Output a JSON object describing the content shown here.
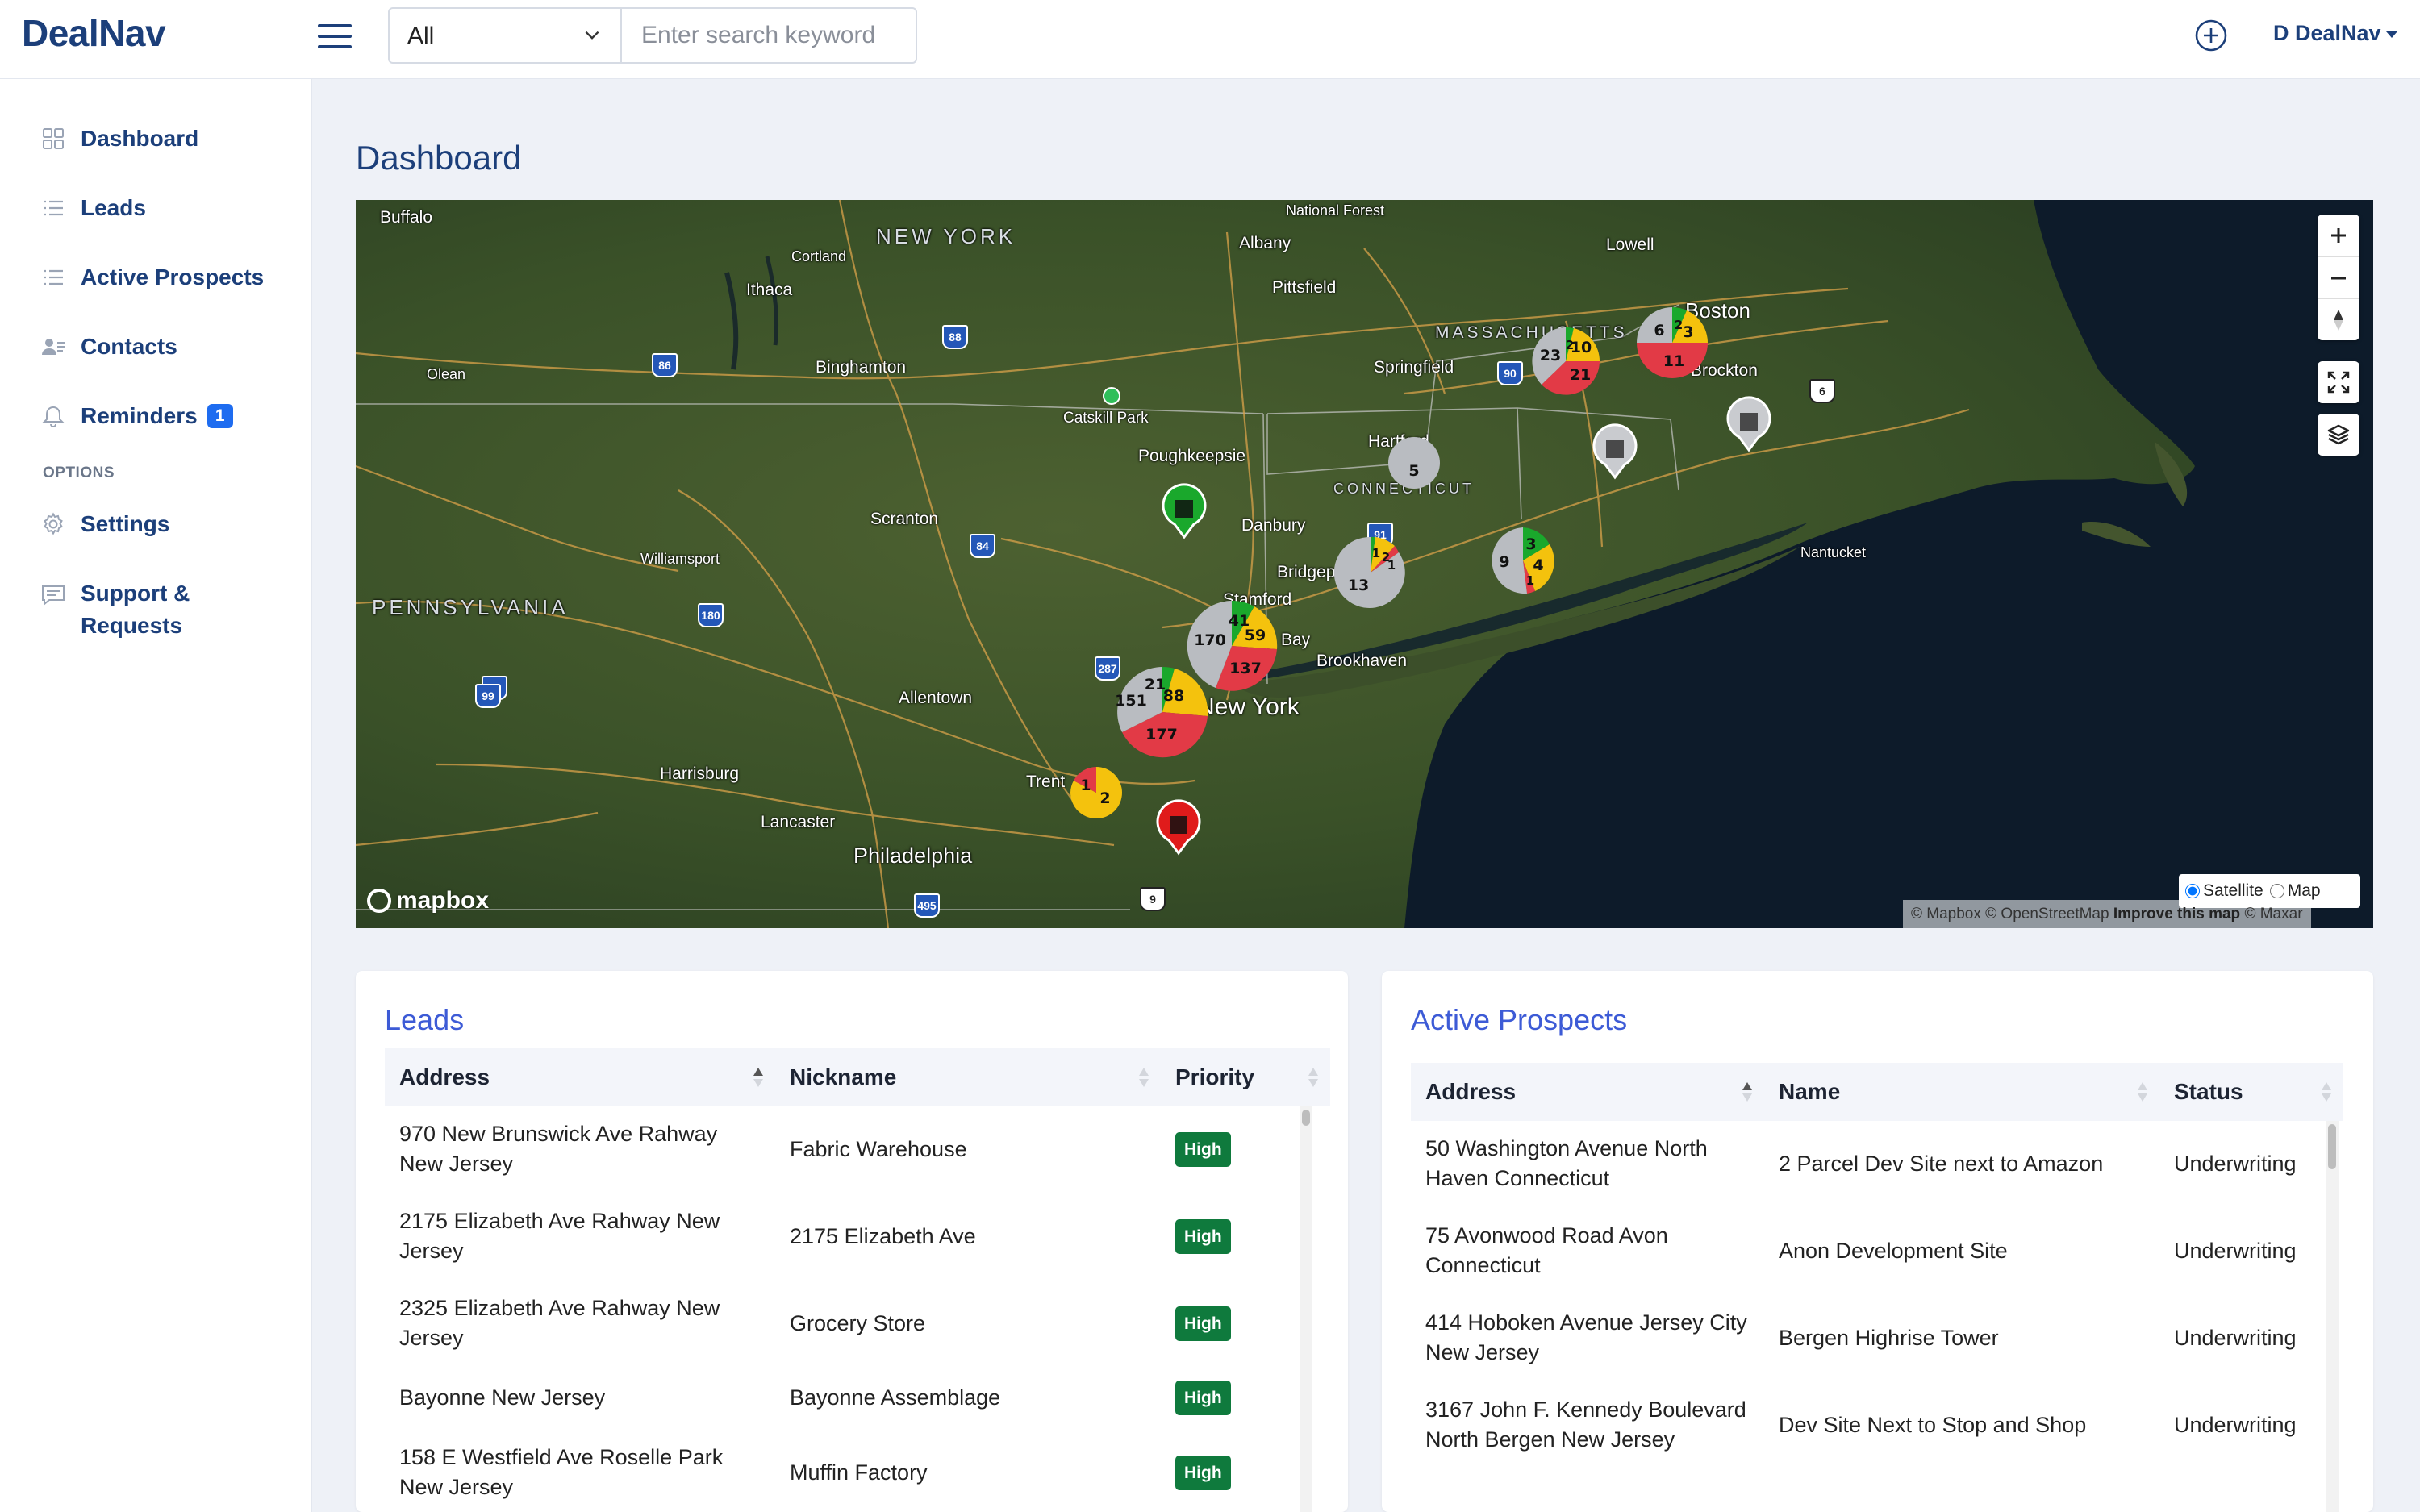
{
  "app": {
    "logo": "DealNav"
  },
  "topbar": {
    "search_filter": "All",
    "search_placeholder": "Enter search keyword",
    "user_label": "D DealNav"
  },
  "sidebar": {
    "items": [
      {
        "label": "Dashboard",
        "icon": "grid-icon"
      },
      {
        "label": "Leads",
        "icon": "list-icon"
      },
      {
        "label": "Active Prospects",
        "icon": "list-icon"
      },
      {
        "label": "Contacts",
        "icon": "contacts-icon"
      },
      {
        "label": "Reminders",
        "icon": "bell-icon",
        "badge": "1"
      }
    ],
    "options_label": "OPTIONS",
    "options": [
      {
        "label": "Settings",
        "icon": "gear-icon"
      },
      {
        "label": "Support & Requests",
        "icon": "chat-icon"
      }
    ]
  },
  "main": {
    "title": "Dashboard"
  },
  "map": {
    "labels": {
      "buffalo": "Buffalo",
      "cortland": "Cortland",
      "newyork_state": "NEW YORK",
      "albany": "Albany",
      "national_forest": "National Forest",
      "lowell": "Lowell",
      "boston": "Boston",
      "ithaca": "Ithaca",
      "pittsfield": "Pittsfield",
      "massachusetts": "MASSACHUSETTS",
      "olean": "Olean",
      "binghamton": "Binghamton",
      "springfield": "Springfield",
      "brockton": "Brockton",
      "catskill": "Catskill Park",
      "poughkeepsie": "Poughkeepsie",
      "hartford": "Hartford",
      "connecticut": "CONNECTICUT",
      "scranton": "Scranton",
      "danbury": "Danbury",
      "williamsport": "Williamsport",
      "bridgeport": "Bridgeport",
      "nantucket": "Nantucket",
      "pennsylvania": "PENNSYLVANIA",
      "stamford": "Stamford",
      "bay": "Bay",
      "brookhaven": "Brookhaven",
      "allentown": "Allentown",
      "newyork_city": "New York",
      "harrisburg": "Harrisburg",
      "trenton": "Trent",
      "lancaster": "Lancaster",
      "philadelphia": "Philadelphia"
    },
    "shields": [
      "88",
      "86",
      "90",
      "91",
      "6",
      "84",
      "180",
      "80",
      "287",
      "99",
      "495",
      "9"
    ],
    "clusters": [
      {
        "id": "boston",
        "colors": {
          "gray": "#b9bcc1",
          "green": "#1aa82c",
          "yellow": "#f4c20d",
          "red": "#e23a46"
        },
        "values": [
          "6",
          "2",
          "3",
          "11"
        ]
      },
      {
        "id": "springfield",
        "values": [
          "23",
          "2",
          "10",
          "21"
        ]
      },
      {
        "id": "hartford",
        "values": [
          "5"
        ]
      },
      {
        "id": "newhaven",
        "values": [
          "9",
          "3",
          "4",
          "1"
        ]
      },
      {
        "id": "bridgeport",
        "values": [
          "13",
          "1",
          "2",
          "1"
        ]
      },
      {
        "id": "nyc-north",
        "values": [
          "170",
          "41",
          "59",
          "137"
        ]
      },
      {
        "id": "nyc",
        "values": [
          "151",
          "21",
          "88",
          "177"
        ]
      },
      {
        "id": "trenton",
        "values": [
          "1",
          "2"
        ]
      }
    ],
    "style_options": {
      "satellite": "Satellite",
      "map": "Map",
      "selected": "Satellite"
    },
    "attribution": {
      "text": "© Mapbox © OpenStreetMap",
      "improve": "Improve this map",
      "maxar": "© Maxar"
    },
    "brand": "mapbox"
  },
  "leads": {
    "title": "Leads",
    "columns": [
      "Address",
      "Nickname",
      "Priority"
    ],
    "rows": [
      {
        "address": "970 New Brunswick Ave Rahway New Jersey",
        "nickname": "Fabric Warehouse",
        "priority": "High"
      },
      {
        "address": "2175 Elizabeth Ave Rahway New Jersey",
        "nickname": "2175 Elizabeth Ave",
        "priority": "High"
      },
      {
        "address": "2325 Elizabeth Ave Rahway New Jersey",
        "nickname": "Grocery Store",
        "priority": "High"
      },
      {
        "address": "Bayonne New Jersey",
        "nickname": "Bayonne Assemblage",
        "priority": "High"
      },
      {
        "address": "158 E Westfield Ave Roselle Park New Jersey",
        "nickname": "Muffin Factory",
        "priority": "High"
      }
    ]
  },
  "prospects": {
    "title": "Active Prospects",
    "columns": [
      "Address",
      "Name",
      "Status"
    ],
    "rows": [
      {
        "address": "50 Washington Avenue North Haven Connecticut",
        "name": "2 Parcel Dev Site next to Amazon",
        "status": "Underwriting"
      },
      {
        "address": "75 Avonwood Road Avon Connecticut",
        "name": "Anon Development Site",
        "status": "Underwriting"
      },
      {
        "address": "414 Hoboken Avenue Jersey City New Jersey",
        "name": "Bergen Highrise Tower",
        "status": "Underwriting"
      },
      {
        "address": "3167 John F. Kennedy Boulevard North Bergen New Jersey",
        "name": "Dev Site Next to Stop and Shop",
        "status": "Underwriting"
      }
    ]
  }
}
